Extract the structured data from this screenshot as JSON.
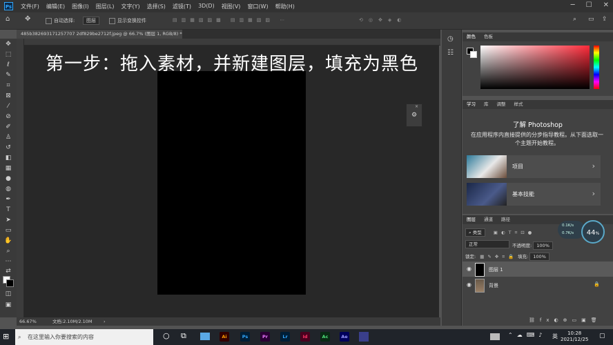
{
  "app": {
    "logo": "Ps"
  },
  "menubar": {
    "items": [
      "文件(F)",
      "编辑(E)",
      "图像(I)",
      "图层(L)",
      "文字(Y)",
      "选择(S)",
      "滤镜(T)",
      "3D(D)",
      "视图(V)",
      "窗口(W)",
      "帮助(H)"
    ]
  },
  "options": {
    "auto_select": "自动选择:",
    "auto_select_target": "图层",
    "show_transform": "显示变换控件"
  },
  "document": {
    "tab_title": "485b382693171257707 2df829be2712f.jpeg @ 66.7% (图层 1, RGB/8) *",
    "overlay_text": "第一步：拖入素材，并新建图层，填充为黑色"
  },
  "status": {
    "zoom": "66.67%",
    "doc_info": "文档:2.10M/2.10M"
  },
  "color_panel": {
    "tabs": [
      "颜色",
      "色板"
    ]
  },
  "learn_panel": {
    "tabs": [
      "学习",
      "库",
      "调整",
      "样式"
    ],
    "title": "了解 Photoshop",
    "description": "在应用程序内直接提供的分步指导教程。从下面选取一个主题开始教程。",
    "cards": [
      {
        "label": "项目"
      },
      {
        "label": "基本技能"
      }
    ]
  },
  "layers_panel": {
    "tabs": [
      "图层",
      "通道",
      "路径"
    ],
    "filter_kind": "类型",
    "blend_mode": "正常",
    "opacity_label": "不透明度:",
    "opacity_value": "100%",
    "lock_label": "锁定:",
    "fill_label": "填充:",
    "fill_value": "100%",
    "layers": [
      {
        "name": "图层 1",
        "selected": true
      },
      {
        "name": "背景",
        "selected": false
      }
    ]
  },
  "net_meter": {
    "value": "44",
    "unit": "%",
    "up": "0.1K/s",
    "down": "0.7K/s"
  },
  "taskbar": {
    "search_placeholder": "在这里输入你要搜索的内容",
    "apps": [
      "Ai",
      "Ps",
      "Pr",
      "Lr",
      "Id",
      "Ac",
      "Ae"
    ],
    "ime": "英",
    "time": "10:28",
    "date": "2021/12/25"
  },
  "colors": {
    "accent": "#31a8ff",
    "canvas_bg": "#282828"
  }
}
